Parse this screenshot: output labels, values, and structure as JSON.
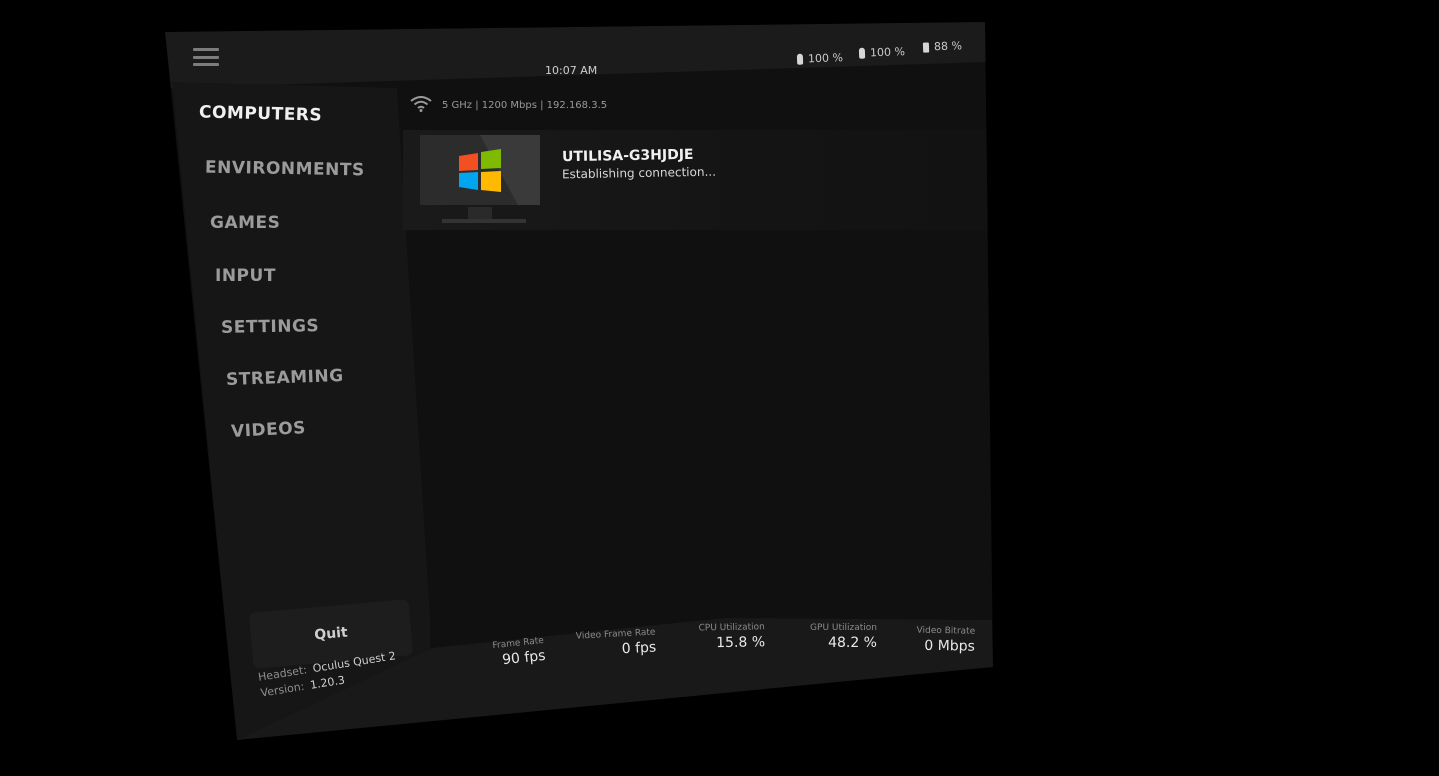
{
  "topbar": {
    "time": "10:07 AM",
    "batteries": [
      {
        "icon": "controller-left-battery-icon",
        "value": "100 %"
      },
      {
        "icon": "controller-right-battery-icon",
        "value": "100 %"
      },
      {
        "icon": "headset-battery-icon",
        "value": "88 %"
      }
    ]
  },
  "network": {
    "icon": "wifi-icon",
    "info": "5 GHz | 1200 Mbps | 192.168.3.5"
  },
  "sidebar": {
    "items": [
      {
        "label": "COMPUTERS",
        "active": true
      },
      {
        "label": "ENVIRONMENTS",
        "active": false
      },
      {
        "label": "GAMES",
        "active": false
      },
      {
        "label": "INPUT",
        "active": false
      },
      {
        "label": "SETTINGS",
        "active": false
      },
      {
        "label": "STREAMING",
        "active": false
      },
      {
        "label": "VIDEOS",
        "active": false
      }
    ],
    "quit_label": "Quit",
    "headset_label": "Headset:",
    "headset_value": "Oculus Quest 2",
    "version_label": "Version:",
    "version_value": "1.20.3"
  },
  "computers": [
    {
      "name": "UTILISA-G3HJDJE",
      "status": "Establishing connection...",
      "icon": "windows-logo-icon"
    }
  ],
  "stats": [
    {
      "label": "Frame Rate",
      "value": "90 fps"
    },
    {
      "label": "Video Frame Rate",
      "value": "0 fps"
    },
    {
      "label": "CPU Utilization",
      "value": "15.8 %"
    },
    {
      "label": "GPU Utilization",
      "value": "48.2 %"
    },
    {
      "label": "Video Bitrate",
      "value": "0 Mbps"
    }
  ],
  "colors": {
    "background": "#000000",
    "panel": "#101010",
    "sidebar": "#161616",
    "text_active": "#f0f0f0",
    "text_inactive": "#9b9b9b",
    "win_red": "#f25022",
    "win_green": "#7fba00",
    "win_blue": "#00a4ef",
    "win_yellow": "#ffb900"
  }
}
